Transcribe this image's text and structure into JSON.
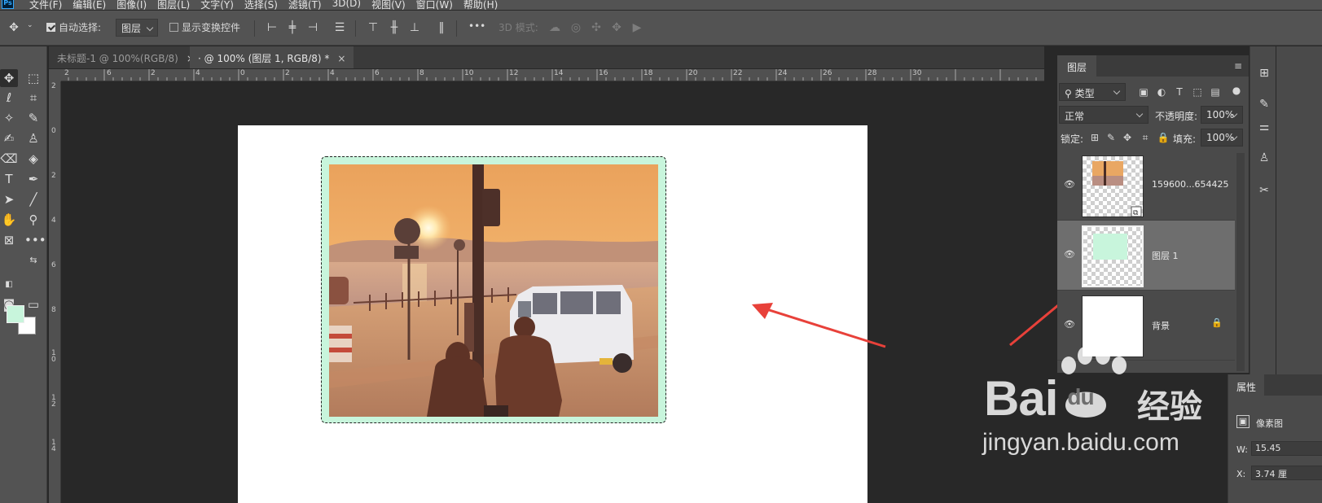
{
  "app": {
    "logo": "Ps"
  },
  "menu": [
    "文件(F)",
    "编辑(E)",
    "图像(I)",
    "图层(L)",
    "文字(Y)",
    "选择(S)",
    "滤镜(T)",
    "3D(D)",
    "视图(V)",
    "窗口(W)",
    "帮助(H)"
  ],
  "options": {
    "auto_select_label": "自动选择:",
    "auto_select_checked": true,
    "target_select": "图层",
    "show_transform_label": "显示变换控件",
    "show_transform_checked": false,
    "mode_3d_label": "3D 模式:",
    "more": "•••"
  },
  "tabs": [
    {
      "label": "未标题-1 @ 100%(RGB/8)",
      "close": "×",
      "active": false
    },
    {
      "label": "· @ 100% (图层 1, RGB/8) *",
      "close": "×",
      "active": true
    }
  ],
  "ruler_top": [
    "2",
    "0",
    "2",
    "4",
    "6",
    "8",
    "10",
    "12",
    "14",
    "16",
    "18",
    "20",
    "22",
    "24",
    "26",
    "28",
    "30",
    "32",
    "34",
    "6"
  ],
  "ruler_left": [
    "2",
    "0",
    "2",
    "4",
    "6",
    "8",
    "10",
    "12",
    "14"
  ],
  "colors": {
    "foreground": "#c8f5dc",
    "background": "#ffffff",
    "accent_arrow": "#e8413a",
    "ui_panel": "#535353",
    "ui_dark": "#282828"
  },
  "layers_panel": {
    "tab": "图层",
    "menu_icon": "hamburger-icon",
    "filter_kind": "类型",
    "blend_mode": "正常",
    "opacity_label": "不透明度:",
    "opacity_value": "100%",
    "lock_label": "锁定:",
    "fill_label": "填充:",
    "fill_value": "100%",
    "layers": [
      {
        "name": "159600...654425",
        "type": "smart-object",
        "visible": true,
        "selected": false,
        "locked": false
      },
      {
        "name": "图层 1",
        "type": "pixel",
        "visible": true,
        "selected": true,
        "locked": false
      },
      {
        "name": "背景",
        "type": "background",
        "visible": true,
        "selected": false,
        "locked": true
      }
    ]
  },
  "properties_panel": {
    "tab": "属性",
    "kind_label": "像素图",
    "w_label": "W:",
    "w_value": "15.45",
    "x_label": "X:",
    "x_value": "3.74 厘"
  },
  "watermark": {
    "brand": "Bai",
    "brand_suffix": "du",
    "cn_text": "经验",
    "url": "jingyan.baidu.com"
  }
}
